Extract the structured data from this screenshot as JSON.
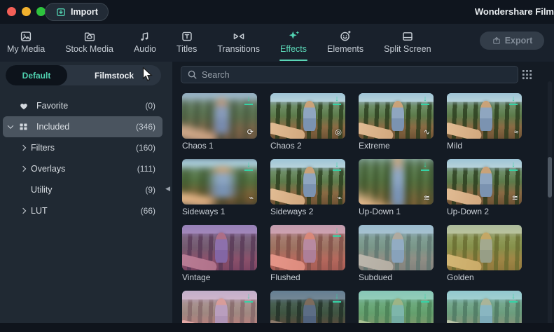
{
  "titlebar": {
    "import_label": "Import",
    "title": "Wondershare Film"
  },
  "tabbar": {
    "export_label": "Export",
    "tabs": [
      {
        "label": "My Media",
        "icon": "image-icon",
        "active": false
      },
      {
        "label": "Stock Media",
        "icon": "folder-cloud-icon",
        "active": false
      },
      {
        "label": "Audio",
        "icon": "music-notes-icon",
        "active": false
      },
      {
        "label": "Titles",
        "icon": "text-box-icon",
        "active": false
      },
      {
        "label": "Transitions",
        "icon": "bowtie-icon",
        "active": false
      },
      {
        "label": "Effects",
        "icon": "sparkle-icon",
        "active": true
      },
      {
        "label": "Elements",
        "icon": "smiley-icon",
        "active": false
      },
      {
        "label": "Split Screen",
        "icon": "split-screen-icon",
        "active": false
      }
    ]
  },
  "sidebar": {
    "source_tabs": [
      {
        "label": "Default",
        "active": true
      },
      {
        "label": "Filmstock",
        "active": false
      }
    ],
    "items": [
      {
        "label": "Favorite",
        "count": "(0)",
        "icon": "heart-icon",
        "chevron": "none",
        "level": 0,
        "selected": false
      },
      {
        "label": "Included",
        "count": "(346)",
        "icon": "grid-icon",
        "chevron": "down",
        "level": 0,
        "selected": true
      },
      {
        "label": "Filters",
        "count": "(160)",
        "icon": "",
        "chevron": "right",
        "level": 1,
        "selected": false
      },
      {
        "label": "Overlays",
        "count": "(111)",
        "icon": "",
        "chevron": "right",
        "level": 1,
        "selected": false
      },
      {
        "label": "Utility",
        "count": "(9)",
        "icon": "",
        "chevron": "none",
        "level": 1,
        "selected": false
      },
      {
        "label": "LUT",
        "count": "(66)",
        "icon": "",
        "chevron": "right",
        "level": 1,
        "selected": false
      }
    ]
  },
  "search": {
    "placeholder": "Search"
  },
  "effects": [
    {
      "name": "Chaos 1",
      "variant": "blur",
      "corner_icon": "shake-icon",
      "downloadable": true,
      "tint": "rgba(120,110,145,0.20)"
    },
    {
      "name": "Chaos 2",
      "variant": "sharp",
      "corner_icon": "swirl-icon",
      "downloadable": true,
      "tint": "none"
    },
    {
      "name": "Extreme",
      "variant": "sharp",
      "corner_icon": "wave-strong-icon",
      "downloadable": true,
      "tint": "none"
    },
    {
      "name": "Mild",
      "variant": "sharp",
      "corner_icon": "wave-soft-icon",
      "downloadable": true,
      "tint": "none"
    },
    {
      "name": "Sideways 1",
      "variant": "sideways-blur",
      "corner_icon": "pulse-icon",
      "downloadable": true,
      "tint": "none"
    },
    {
      "name": "Sideways 2",
      "variant": "sharp",
      "corner_icon": "pulse-icon",
      "downloadable": true,
      "tint": "none"
    },
    {
      "name": "Up-Down 1",
      "variant": "updown-blur",
      "corner_icon": "zigzag-icon",
      "downloadable": true,
      "tint": "none"
    },
    {
      "name": "Up-Down 2",
      "variant": "sharp",
      "corner_icon": "zigzag-icon",
      "downloadable": true,
      "tint": "none"
    },
    {
      "name": "Vintage",
      "variant": "sharp",
      "corner_icon": "",
      "downloadable": false,
      "tint": "rgba(140,55,150,0.48)"
    },
    {
      "name": "Flushed",
      "variant": "sharp",
      "corner_icon": "",
      "downloadable": true,
      "tint": "rgba(236,105,125,0.45)"
    },
    {
      "name": "Subdued",
      "variant": "sharp",
      "corner_icon": "",
      "downloadable": false,
      "tint": "rgba(150,178,198,0.50)"
    },
    {
      "name": "Golden",
      "variant": "sharp",
      "corner_icon": "",
      "downloadable": false,
      "tint": "rgba(190,175,75,0.42)"
    },
    {
      "name": "",
      "variant": "sharp",
      "corner_icon": "",
      "downloadable": true,
      "tint": "rgba(232,150,188,0.48)"
    },
    {
      "name": "",
      "variant": "sharp",
      "corner_icon": "",
      "downloadable": true,
      "tint": "rgba(22,32,52,0.42)"
    },
    {
      "name": "",
      "variant": "sharp",
      "corner_icon": "",
      "downloadable": true,
      "tint": "rgba(108,200,148,0.48)"
    },
    {
      "name": "",
      "variant": "sharp",
      "corner_icon": "",
      "downloadable": true,
      "tint": "rgba(128,205,195,0.42)"
    }
  ],
  "colors": {
    "accent": "#52d3b2",
    "download_badge": "#35d3a5"
  }
}
